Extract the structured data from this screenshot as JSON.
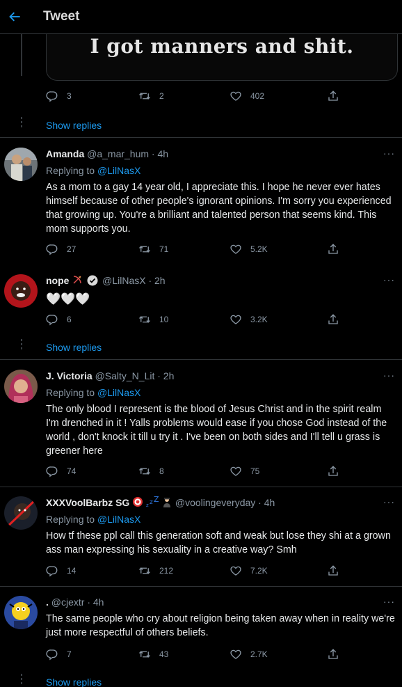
{
  "header": {
    "title": "Tweet"
  },
  "quoted": {
    "caption": "I got manners and shit."
  },
  "main_actions": {
    "replies": "3",
    "retweets": "2",
    "likes": "402"
  },
  "show_replies_label": "Show replies",
  "replying_label": "Replying to",
  "replying_handle": "@LilNasX",
  "more_label": "···",
  "tweets": [
    {
      "name": "Amanda",
      "handle": "@a_mar_hum · 4h",
      "text": "As a mom to a gay 14 year old, I appreciate this. I hope he never ever hates himself because of other people's ignorant opinions. I'm sorry you experienced that growing up. You're a brilliant and talented person that seems kind. This mom supports you.",
      "replies": "27",
      "retweets": "71",
      "likes": "5.2K"
    },
    {
      "name": "nope",
      "handle": "@LilNasX · 2h",
      "text": "🤍🤍🤍",
      "replies": "6",
      "retweets": "10",
      "likes": "3.2K"
    },
    {
      "name": "J. Victoria",
      "handle": "@Salty_N_Lit · 2h",
      "text": "The only blood I represent is the blood of Jesus Christ and in the spirit realm I'm drenched in it !  Yalls problems would ease if you chose God instead of the world ,  don't knock it till u try it . I've been on both sides and I'll tell u grass is greener here",
      "replies": "74",
      "retweets": "8",
      "likes": "75"
    },
    {
      "name": "XXXVoolBarbz SG",
      "handle": "@voolingeveryday · 4h",
      "text": "How tf these ppl call this generation soft and weak but lose they shi at a grown ass man expressing his sexuality in a creative way? Smh",
      "replies": "14",
      "retweets": "212",
      "likes": "7.2K"
    },
    {
      "name": ".",
      "handle": "@cjextr · 4h",
      "text": "The same people who cry about religion being taken away when in reality we're just more respectful of others beliefs.",
      "replies": "7",
      "retweets": "43",
      "likes": "2.7K"
    }
  ]
}
